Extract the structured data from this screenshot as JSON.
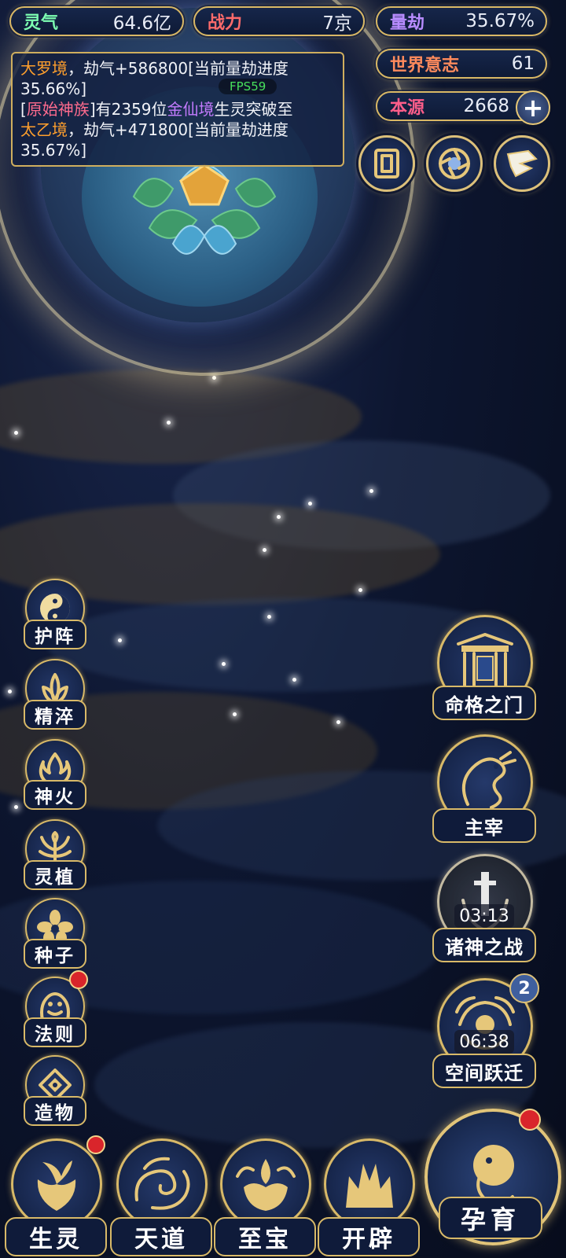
{
  "resources": {
    "lingqi": {
      "label": "灵气",
      "value": "64.6亿",
      "color": "#7dffb2"
    },
    "zhanli": {
      "label": "战力",
      "value": "7京",
      "color": "#ff6b6b"
    },
    "liangjie": {
      "label": "量劫",
      "value": "35.67%",
      "color": "#b88cff"
    },
    "shijieyizhi": {
      "label": "世界意志",
      "value": "61",
      "color": "#ff8a5c"
    },
    "benyuan": {
      "label": "本源",
      "value": "2668",
      "color": "#ff5e8a"
    }
  },
  "log": {
    "fps": "FPS59",
    "line1": {
      "realm": "大罗境",
      "text": "，劫气+586800[当前量劫进度",
      "percent": "35.66%]"
    },
    "line2": {
      "open": "[",
      "clan": "原始神族",
      "mid": "]有2359位",
      "realm": "金仙境",
      "after": "生灵突破至"
    },
    "line3": {
      "realm": "太乙境",
      "text": "，劫气+471800[当前量劫进度",
      "percent": "35.67%]"
    }
  },
  "top_buttons": [
    "card-icon",
    "portal-icon",
    "scroll-icon"
  ],
  "left_menu": [
    {
      "label": "护阵",
      "icon": "taiji-icon",
      "dot": false
    },
    {
      "label": "精淬",
      "icon": "lotus-flame-icon",
      "dot": false
    },
    {
      "label": "神火",
      "icon": "fire-icon",
      "dot": false
    },
    {
      "label": "灵植",
      "icon": "plant-icon",
      "dot": false
    },
    {
      "label": "种子",
      "icon": "flower-icon",
      "dot": false
    },
    {
      "label": "法则",
      "icon": "beast-icon",
      "dot": true
    },
    {
      "label": "造物",
      "icon": "diamond-icon",
      "dot": false
    }
  ],
  "right_menu": [
    {
      "label": "命格之门",
      "icon": "gate-icon"
    },
    {
      "label": "主宰",
      "icon": "dragon-icon"
    },
    {
      "label": "诸神之战",
      "icon": "sword-icon",
      "timer": "03:13"
    },
    {
      "label": "空间跃迁",
      "icon": "sun-swirl-icon",
      "timer": "06:38",
      "badge": "2"
    }
  ],
  "bottom_nav": [
    {
      "label": "生灵",
      "icon": "phoenix-icon",
      "dot": true
    },
    {
      "label": "天道",
      "icon": "cloud-swirl-icon",
      "dot": false
    },
    {
      "label": "至宝",
      "icon": "treasure-icon",
      "dot": false
    },
    {
      "label": "开辟",
      "icon": "flame-crown-icon",
      "dot": false
    }
  ],
  "main_action": {
    "label": "孕育",
    "icon": "embryo-icon",
    "dot": true
  }
}
